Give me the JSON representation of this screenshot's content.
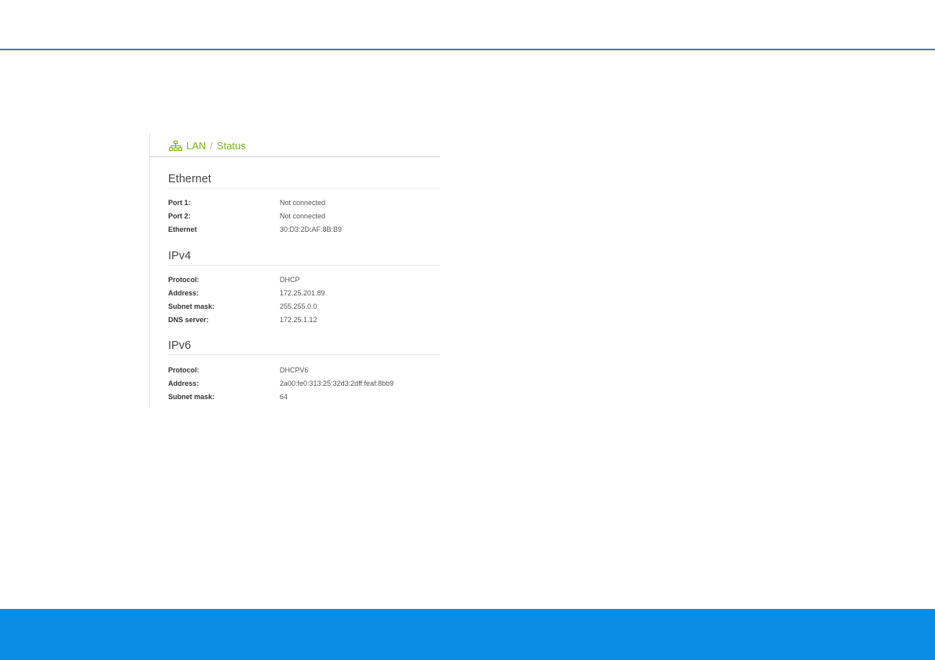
{
  "breadcrumb": {
    "section": "LAN",
    "separator": "/",
    "page": "Status",
    "icon": "network-icon",
    "accent_color": "#7cb518"
  },
  "sections": [
    {
      "title": "Ethernet",
      "rows": [
        {
          "label": "Port 1:",
          "value": "Not connected"
        },
        {
          "label": "Port 2:",
          "value": "Not connected"
        },
        {
          "label": "Ethernet",
          "value": "30:D3:2D:AF:8B:B9"
        }
      ]
    },
    {
      "title": "IPv4",
      "rows": [
        {
          "label": "Protocol:",
          "value": "DHCP"
        },
        {
          "label": "Address:",
          "value": "172.25.201.89"
        },
        {
          "label": "Subnet mask:",
          "value": "255.255.0.0"
        },
        {
          "label": "DNS server:",
          "value": "172.25.1.12"
        }
      ]
    },
    {
      "title": "IPv6",
      "rows": [
        {
          "label": "Protocol:",
          "value": "DHCPV6"
        },
        {
          "label": "Address:",
          "value": "2a00:fe0:313:25:32d3:2dff:feaf:8bb9"
        },
        {
          "label": "Subnet mask:",
          "value": "64"
        }
      ]
    }
  ],
  "colors": {
    "header_rule": "#1a8ad4",
    "footer_band": "#0a8ce4"
  }
}
